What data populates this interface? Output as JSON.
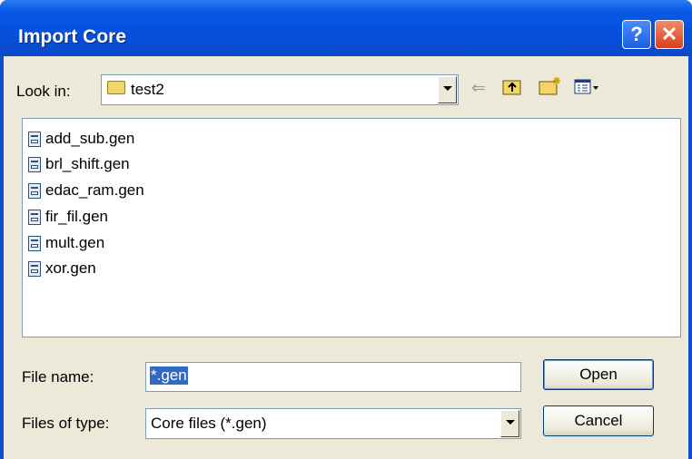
{
  "window": {
    "title": "Import Core"
  },
  "titlebar_buttons": {
    "help": "?",
    "close": "✕"
  },
  "look_in": {
    "label": "Look in:",
    "value": "test2"
  },
  "toolbar": {
    "back_icon": "back-arrow-icon",
    "up_icon": "up-folder-icon",
    "new_folder_icon": "new-folder-icon",
    "view_menu_icon": "view-menu-icon"
  },
  "files": [
    {
      "name": "add_sub.gen"
    },
    {
      "name": "brl_shift.gen"
    },
    {
      "name": "edac_ram.gen"
    },
    {
      "name": "fir_fil.gen"
    },
    {
      "name": "mult.gen"
    },
    {
      "name": "xor.gen"
    }
  ],
  "file_name": {
    "label": "File name:",
    "value": "*.gen"
  },
  "file_type": {
    "label": "Files of type:",
    "value": "Core files (*.gen)"
  },
  "buttons": {
    "open": "Open",
    "cancel": "Cancel"
  },
  "colors": {
    "titlebar": "#0550dc",
    "selection": "#316ac5",
    "dialog_bg": "#ece9d8"
  }
}
